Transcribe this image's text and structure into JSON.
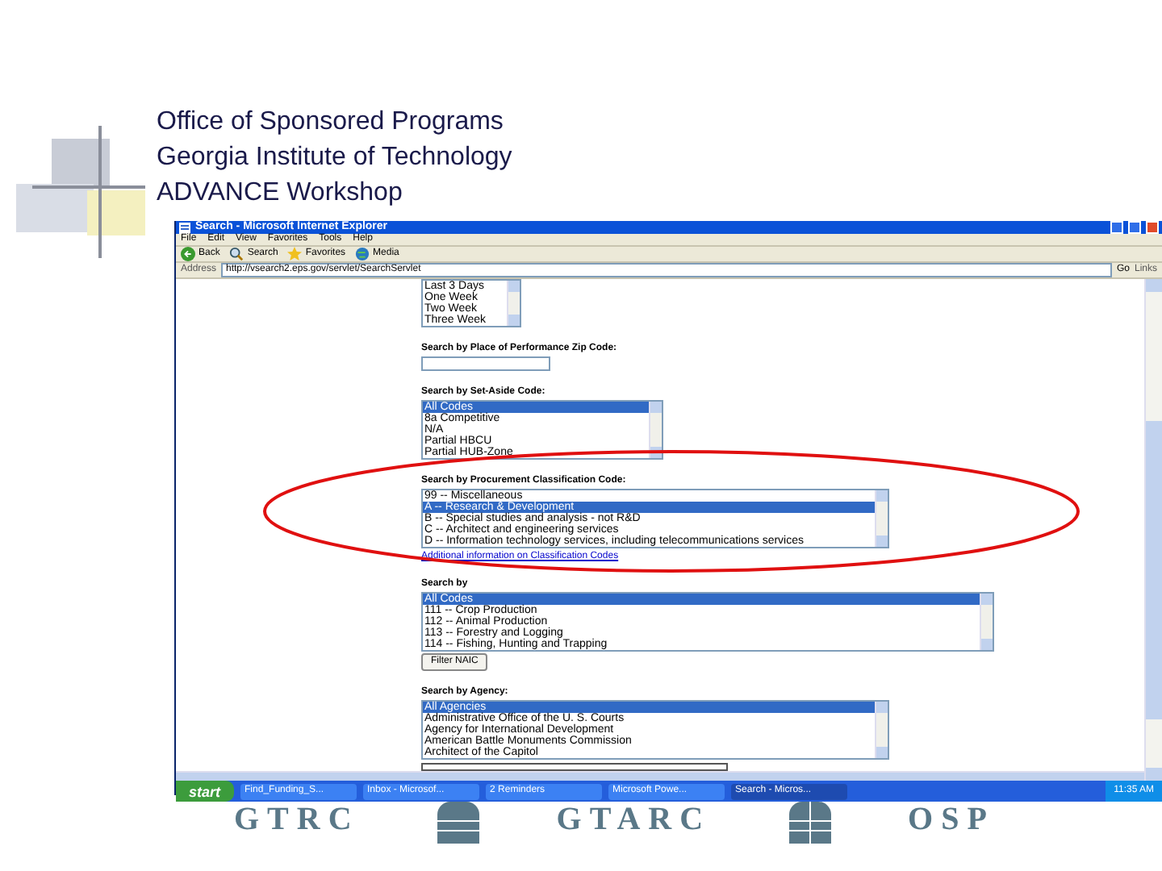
{
  "slide": {
    "header_lines": [
      "Office of Sponsored Programs",
      "Georgia Institute of Technology",
      "ADVANCE Workshop"
    ]
  },
  "browser": {
    "title": "Search - Microsoft Internet Explorer",
    "menu": [
      "File",
      "Edit",
      "View",
      "Favorites",
      "Tools",
      "Help"
    ],
    "toolbar": [
      {
        "kind": "back",
        "label": "Back"
      },
      {
        "kind": "search",
        "label": "Search"
      },
      {
        "kind": "favorites",
        "label": "Favorites"
      },
      {
        "kind": "media",
        "label": "Media"
      }
    ],
    "address": {
      "label": "Address",
      "url": "http://vsearch2.eps.gov/servlet/SearchServlet",
      "go": "Go",
      "links": "Links"
    },
    "content": {
      "sections": [
        {
          "kind": "list",
          "items": [
            {
              "label": "Last 3 Days",
              "selected": false
            },
            {
              "label": "One Week",
              "selected": false
            },
            {
              "label": "Two Week",
              "selected": false
            },
            {
              "label": "Three Week",
              "selected": false
            }
          ]
        },
        {
          "kind": "field",
          "label": "Search by Place of Performance Zip Code:"
        },
        {
          "kind": "list",
          "label": "Search by Set-Aside Code:",
          "items": [
            {
              "label": "All Codes",
              "selected": true
            },
            {
              "label": "8a Competitive",
              "selected": false
            },
            {
              "label": "N/A",
              "selected": false
            },
            {
              "label": "Partial HBCU",
              "selected": false
            },
            {
              "label": "Partial HUB-Zone",
              "selected": false
            }
          ]
        },
        {
          "kind": "list",
          "label": "Search by Procurement Classification Code:",
          "link": "Additional information on Classification Codes",
          "items": [
            {
              "label": "99 -- Miscellaneous",
              "selected": false
            },
            {
              "label": "A -- Research & Development",
              "selected": true
            },
            {
              "label": "B -- Special studies and analysis - not R&D",
              "selected": false
            },
            {
              "label": "C -- Architect and engineering services",
              "selected": false
            },
            {
              "label": "D -- Information technology services, including telecommunications services",
              "selected": false
            }
          ]
        },
        {
          "kind": "list",
          "label": "Search by",
          "button": "Filter NAIC",
          "items": [
            {
              "label": "All Codes",
              "selected": true
            },
            {
              "label": "111 -- Crop Production",
              "selected": false
            },
            {
              "label": "112 -- Animal Production",
              "selected": false
            },
            {
              "label": "113 -- Forestry and Logging",
              "selected": false
            },
            {
              "label": "114 -- Fishing, Hunting and Trapping",
              "selected": false
            }
          ]
        },
        {
          "kind": "list",
          "label": "Search by Agency:",
          "items": [
            {
              "label": "All Agencies",
              "selected": true
            },
            {
              "label": "Administrative Office of the U. S. Courts",
              "selected": false
            },
            {
              "label": "Agency for International Development",
              "selected": false
            },
            {
              "label": "American Battle Monuments Commission",
              "selected": false
            },
            {
              "label": "Architect of the Capitol",
              "selected": false
            }
          ]
        }
      ]
    },
    "taskbar": {
      "start": "start",
      "tasks": [
        {
          "label": "Find_Funding_S...",
          "selected": false
        },
        {
          "label": "Inbox - Microsof...",
          "selected": false
        },
        {
          "label": "2 Reminders",
          "selected": false
        },
        {
          "label": "Microsoft Powe...",
          "selected": false
        },
        {
          "label": "Search - Micros...",
          "selected": true
        }
      ],
      "time": "11:35 AM"
    }
  },
  "footer": {
    "logos": [
      "GTRC",
      "GTARC",
      "OSP"
    ]
  }
}
